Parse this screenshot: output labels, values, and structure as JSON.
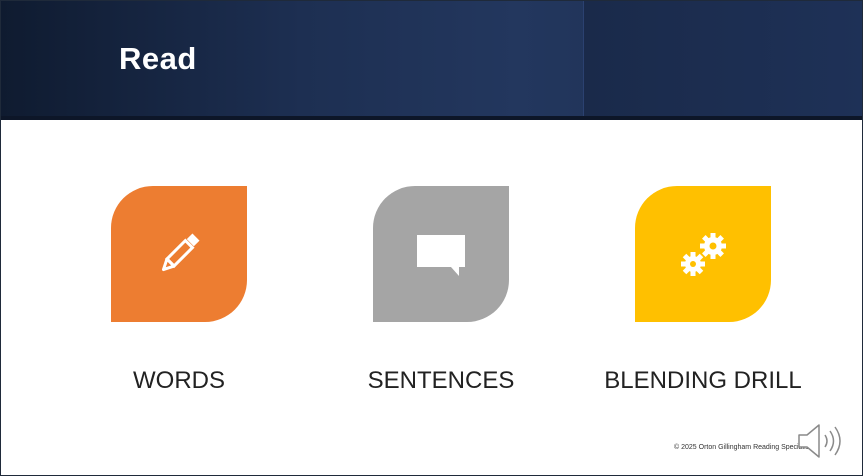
{
  "slide": {
    "title": "Read",
    "items": [
      {
        "label": "WORDS",
        "icon": "pencil-icon",
        "color": "#ED7D31"
      },
      {
        "label": "SENTENCES",
        "icon": "speech-bubble-icon",
        "color": "#A5A5A5"
      },
      {
        "label": "BLENDING DRILL",
        "icon": "gears-icon",
        "color": "#FFC000"
      }
    ],
    "footer": "© 2025 Orton Gillingham Reading Specialists",
    "audio_icon": "speaker-icon"
  },
  "colors": {
    "header_background": "#1d2f52",
    "title_text": "#FFFFFF"
  }
}
